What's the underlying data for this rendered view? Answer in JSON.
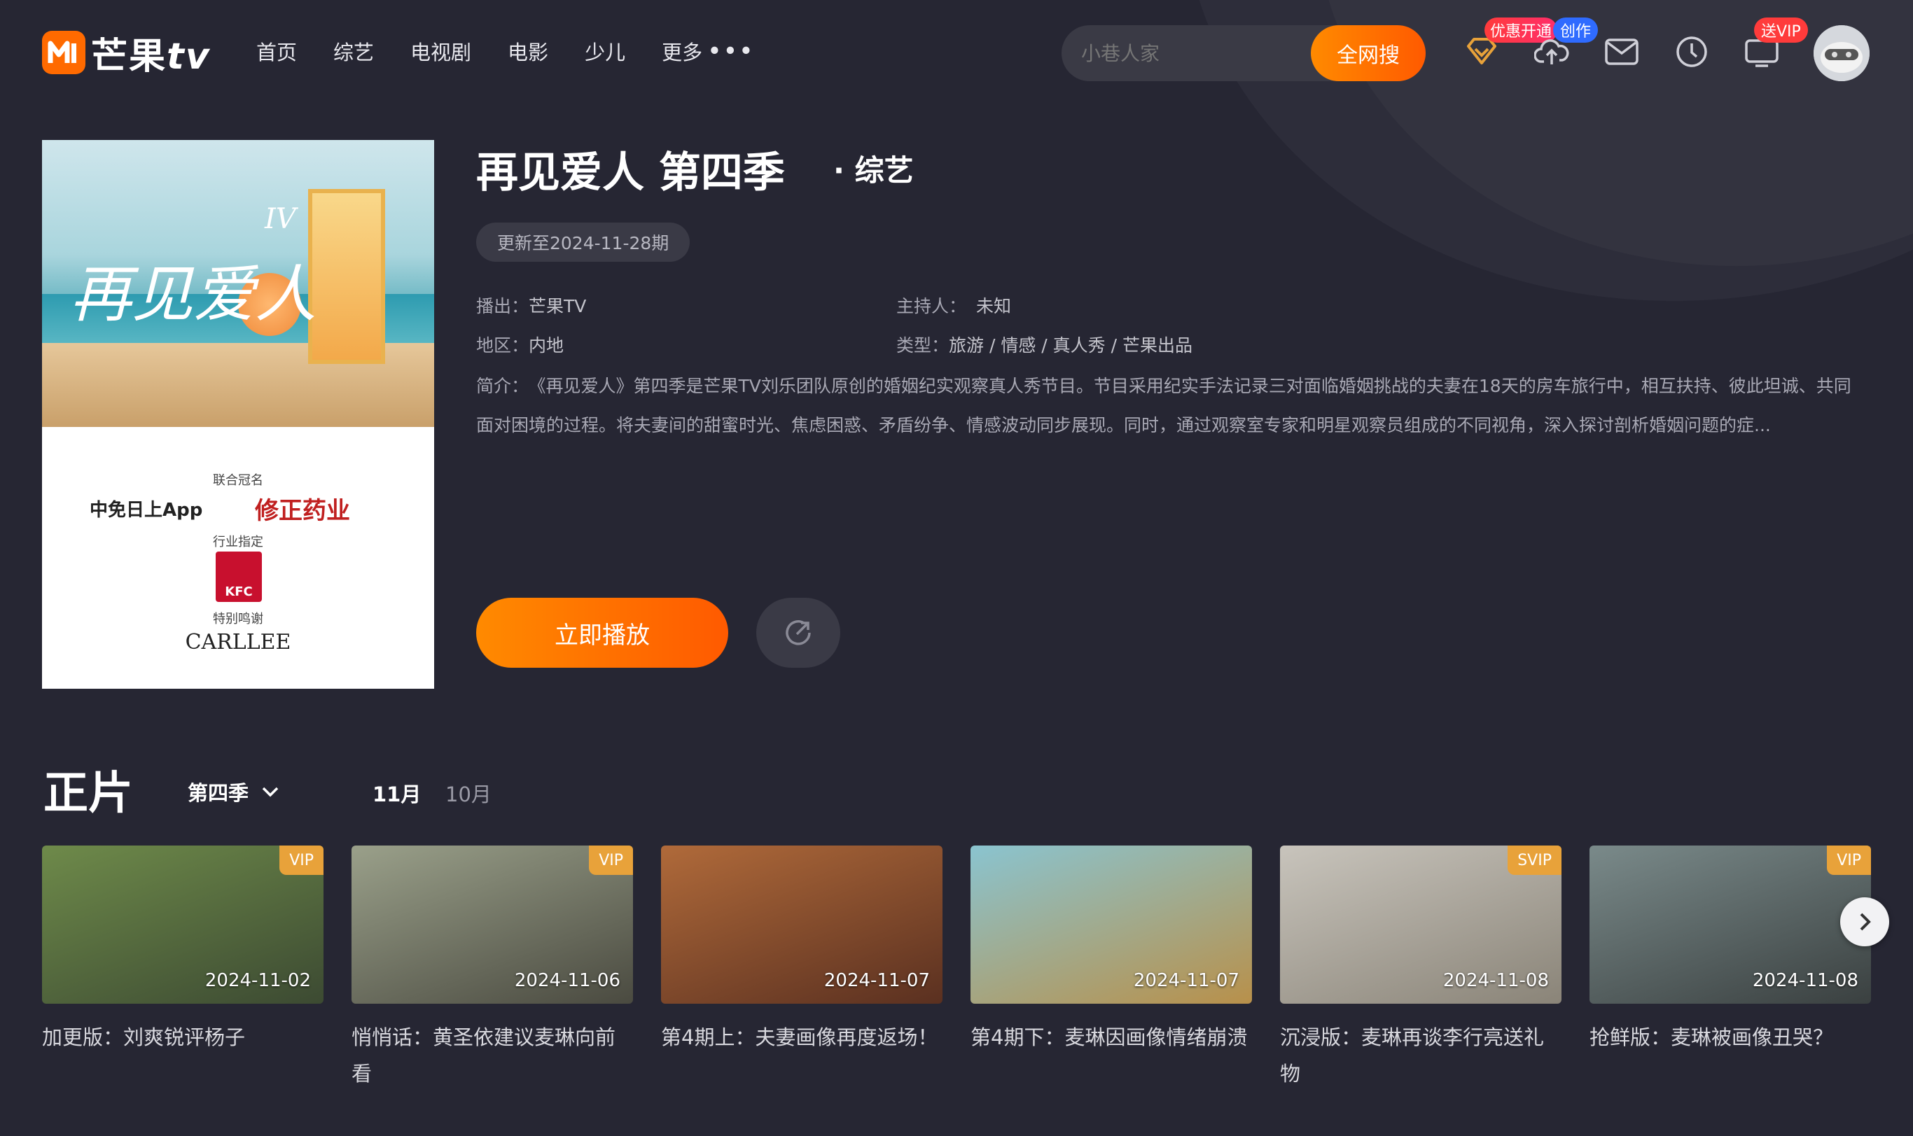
{
  "header": {
    "logo_text": "芒果",
    "logo_tv": "tv",
    "nav": [
      "首页",
      "综艺",
      "电视剧",
      "电影",
      "少儿"
    ],
    "nav_more": "更多",
    "search_placeholder": "小巷人家",
    "search_button": "全网搜",
    "badge_promo": "优惠开通",
    "badge_create": "创作",
    "badge_vip": "送VIP"
  },
  "show": {
    "title": "再见爱人 第四季",
    "genre": "· 综艺",
    "update_tag": "更新至2024-11-28期",
    "broadcast_label": "播出：",
    "broadcast_value": "芒果TV",
    "host_label": "主持人：",
    "host_value": "未知",
    "region_label": "地区：",
    "region_value": "内地",
    "type_label": "类型：",
    "type_value": "旅游 / 情感 / 真人秀 / 芒果出品",
    "desc_label": "简介：",
    "description": "《再见爱人》第四季是芒果TV刘乐团队原创的婚姻纪实观察真人秀节目。节目采用纪实手法记录三对面临婚姻挑战的夫妻在18天的房车旅行中，相互扶持、彼此坦诚、共同面对困境的过程。将夫妻间的甜蜜时光、焦虑困惑、矛盾纷争、情感波动同步展现。同时，通过观察室专家和明星观察员组成的不同视角，深入探讨剖析婚姻问题的症...",
    "play_button": "立即播放"
  },
  "poster": {
    "title_art": "再见爱人",
    "season_mark": "IV",
    "sponsor_heading": "联合冠名",
    "sponsor1": "中免日上App",
    "sponsor2": "修正药业",
    "industry_heading": "行业指定",
    "industry_brand": "KFC",
    "thanks_heading": "特别鸣谢",
    "thanks_brand": "CARLLEE"
  },
  "section": {
    "title": "正片",
    "season": "第四季",
    "months": [
      "11月",
      "10月"
    ]
  },
  "episodes": [
    {
      "title": "加更版：刘爽锐评杨子",
      "date": "2024-11-02",
      "badge": "VIP",
      "color1": "#6e8a4a",
      "color2": "#3c4a32"
    },
    {
      "title": "悄悄话：黄圣依建议麦琳向前看",
      "date": "2024-11-06",
      "badge": "VIP",
      "color1": "#9aa08a",
      "color2": "#4a4a40"
    },
    {
      "title": "第4期上：夫妻画像再度返场！",
      "date": "2024-11-07",
      "badge": "",
      "color1": "#b06a3a",
      "color2": "#5a3020"
    },
    {
      "title": "第4期下：麦琳因画像情绪崩溃",
      "date": "2024-11-07",
      "badge": "",
      "color1": "#8ac4d0",
      "color2": "#b8904a"
    },
    {
      "title": "沉浸版：麦琳再谈李行亮送礼物",
      "date": "2024-11-08",
      "badge": "SVIP",
      "color1": "#c8c4bc",
      "color2": "#8a8478"
    },
    {
      "title": "抢鲜版：麦琳被画像丑哭？",
      "date": "2024-11-08",
      "badge": "VIP",
      "color1": "#7a8a8a",
      "color2": "#3a4040"
    }
  ]
}
